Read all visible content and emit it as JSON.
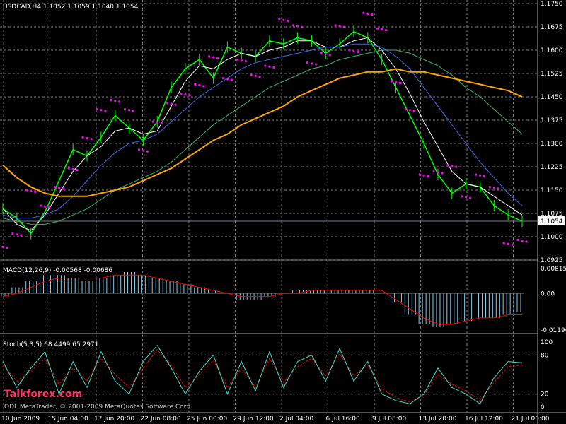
{
  "chart_data": [
    {
      "type": "line",
      "title": "USDCAD,H4  1.1052 1.1059 1.1040 1.1054",
      "price_ticks": [
        "1.1750",
        "1.1675",
        "1.1600",
        "1.1525",
        "1.1450",
        "1.1375",
        "1.1300",
        "1.1225",
        "1.1150",
        "1.1075",
        "1.1000",
        "1.0925"
      ],
      "current_price": "1.1054",
      "ylim": [
        1.0925,
        1.175
      ],
      "series": [
        {
          "color": "#00ff00",
          "values": [
            1.109,
            1.106,
            1.101,
            1.108,
            1.118,
            1.128,
            1.126,
            1.132,
            1.139,
            1.135,
            1.131,
            1.137,
            1.148,
            1.154,
            1.157,
            1.151,
            1.161,
            1.159,
            1.158,
            1.163,
            1.162,
            1.164,
            1.163,
            1.159,
            1.162,
            1.166,
            1.164,
            1.157,
            1.148,
            1.139,
            1.13,
            1.12,
            1.114,
            1.117,
            1.116,
            1.11,
            1.107,
            1.105
          ]
        },
        {
          "color": "#ffffff",
          "values": [
            1.109,
            1.104,
            1.102,
            1.107,
            1.114,
            1.121,
            1.126,
            1.129,
            1.134,
            1.135,
            1.133,
            1.134,
            1.142,
            1.15,
            1.155,
            1.154,
            1.157,
            1.159,
            1.158,
            1.16,
            1.161,
            1.163,
            1.163,
            1.161,
            1.161,
            1.163,
            1.164,
            1.16,
            1.154,
            1.146,
            1.137,
            1.129,
            1.121,
            1.117,
            1.116,
            1.113,
            1.11,
            1.107
          ]
        },
        {
          "color": "#4169e1",
          "values": [
            1.107,
            1.106,
            1.106,
            1.107,
            1.109,
            1.113,
            1.118,
            1.123,
            1.127,
            1.13,
            1.131,
            1.133,
            1.137,
            1.141,
            1.145,
            1.148,
            1.151,
            1.154,
            1.156,
            1.157,
            1.158,
            1.159,
            1.16,
            1.161,
            1.161,
            1.162,
            1.162,
            1.161,
            1.158,
            1.154,
            1.148,
            1.142,
            1.136,
            1.13,
            1.124,
            1.119,
            1.114,
            1.11
          ]
        },
        {
          "color": "#3cb371",
          "values": [
            1.106,
            1.105,
            1.104,
            1.104,
            1.105,
            1.107,
            1.109,
            1.112,
            1.115,
            1.117,
            1.119,
            1.121,
            1.124,
            1.128,
            1.132,
            1.136,
            1.139,
            1.142,
            1.145,
            1.148,
            1.15,
            1.152,
            1.154,
            1.155,
            1.157,
            1.158,
            1.159,
            1.16,
            1.16,
            1.159,
            1.157,
            1.155,
            1.152,
            1.148,
            1.145,
            1.141,
            1.137,
            1.133
          ]
        },
        {
          "color": "#ffa500",
          "values": [
            1.123,
            1.119,
            1.116,
            1.114,
            1.113,
            1.113,
            1.113,
            1.114,
            1.115,
            1.116,
            1.118,
            1.12,
            1.122,
            1.125,
            1.128,
            1.131,
            1.133,
            1.136,
            1.138,
            1.14,
            1.142,
            1.145,
            1.147,
            1.149,
            1.151,
            1.152,
            1.153,
            1.153,
            1.154,
            1.153,
            1.153,
            1.152,
            1.151,
            1.15,
            1.149,
            1.148,
            1.147,
            1.145
          ]
        }
      ],
      "psar": [
        1.097,
        1.101,
        1.115,
        1.11,
        1.116,
        1.122,
        1.132,
        1.141,
        1.144,
        1.141,
        1.128,
        1.137,
        1.143,
        1.146,
        1.149,
        1.158,
        1.151,
        1.157,
        1.152,
        1.155,
        1.17,
        1.168,
        1.156,
        1.159,
        1.168,
        1.16,
        1.172,
        1.167,
        1.15,
        1.141,
        1.12,
        1.121,
        1.123,
        1.113,
        1.12,
        1.116,
        1.098,
        1.099
      ]
    },
    {
      "type": "bar",
      "title": "MACD(12,26,9) -0.00568 -0.00686",
      "ticks": [
        "0.00815",
        "0.00",
        "-0.01196"
      ],
      "ylim": [
        -0.01196,
        0.00815
      ],
      "values": [
        -0.001,
        0.002,
        0.004,
        0.006,
        0.006,
        0.005,
        0.004,
        0.005,
        0.006,
        0.007,
        0.006,
        0.005,
        0.004,
        0.003,
        0.002,
        0.001,
        0.0,
        -0.002,
        -0.002,
        -0.001,
        0.0,
        0.001,
        0.001,
        0.001,
        0.001,
        0.001,
        0.001,
        0.0,
        -0.003,
        -0.007,
        -0.01,
        -0.011,
        -0.01,
        -0.009,
        -0.008,
        -0.008,
        -0.007,
        -0.006
      ],
      "signal": [
        -0.001,
        0.0,
        0.002,
        0.004,
        0.005,
        0.005,
        0.005,
        0.005,
        0.006,
        0.006,
        0.006,
        0.005,
        0.004,
        0.003,
        0.002,
        0.001,
        0.0,
        -0.001,
        -0.001,
        -0.001,
        0.0,
        0.0,
        0.001,
        0.001,
        0.001,
        0.001,
        0.001,
        0.001,
        -0.002,
        -0.005,
        -0.008,
        -0.01,
        -0.01,
        -0.009,
        -0.008,
        -0.008,
        -0.007,
        -0.007
      ]
    },
    {
      "type": "line",
      "title": "Stoch(5,3,5) 68.4499 65.2971",
      "ticks": [
        "100",
        "80",
        "20",
        "0"
      ],
      "ylim": [
        0,
        100
      ],
      "k": [
        70,
        30,
        60,
        85,
        20,
        70,
        30,
        85,
        40,
        20,
        70,
        95,
        60,
        20,
        55,
        80,
        20,
        70,
        25,
        85,
        30,
        70,
        80,
        40,
        90,
        40,
        70,
        20,
        10,
        5,
        20,
        60,
        30,
        20,
        5,
        45,
        70,
        68
      ],
      "d": [
        65,
        40,
        55,
        75,
        35,
        60,
        40,
        75,
        50,
        30,
        60,
        88,
        65,
        30,
        50,
        72,
        30,
        60,
        30,
        75,
        38,
        62,
        75,
        48,
        82,
        48,
        65,
        28,
        15,
        8,
        18,
        50,
        35,
        25,
        10,
        38,
        62,
        65
      ]
    }
  ],
  "x_ticks": [
    "10 Jun 2009",
    "15 Jun 04:00",
    "17 Jun 20:00",
    "22 Jun 08:00",
    "25 Jun 00:00",
    "29 Jun 12:00",
    "2 Jul 04:00",
    "6 Jul 16:00",
    "9 Jul 08:00",
    "13 Jul 20:00",
    "16 Jul 12:00",
    "21 Jul 00:00"
  ],
  "watermark": "ODL MetaTrader, © 2001-2009 MetaQuotes Software Corp.",
  "site_mark": "Talkforex.com",
  "colors": {
    "grid": "#777777",
    "up": "#00ff00",
    "psar": "#ff00ff",
    "macd": "#87ceeb",
    "signal": "#ff0000",
    "stoch_k": "#40e0d0",
    "stoch_d": "#ff0000"
  }
}
